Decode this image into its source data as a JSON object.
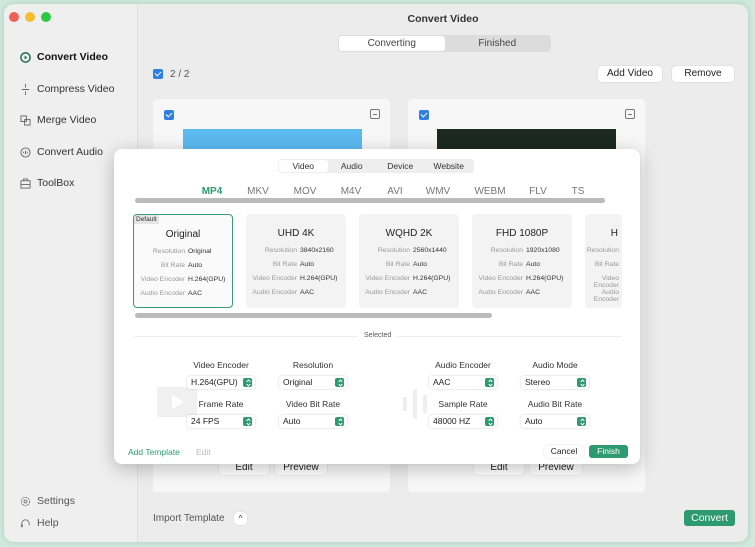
{
  "window": {
    "title": "Convert Video"
  },
  "sidebar": {
    "items": [
      {
        "label": "Convert Video",
        "icon": "convert-video-icon"
      },
      {
        "label": "Compress Video",
        "icon": "compress-icon"
      },
      {
        "label": "Merge Video",
        "icon": "merge-icon"
      },
      {
        "label": "Convert Audio",
        "icon": "audio-icon"
      },
      {
        "label": "ToolBox",
        "icon": "toolbox-icon"
      }
    ],
    "footer": [
      {
        "label": "Settings",
        "icon": "gear-icon"
      },
      {
        "label": "Help",
        "icon": "headset-icon"
      }
    ]
  },
  "main": {
    "tabs": [
      {
        "label": "Converting",
        "active": true
      },
      {
        "label": "Finished"
      }
    ],
    "selection_count": "2 / 2",
    "add_video": "Add Video",
    "remove": "Remove",
    "card_buttons": {
      "edit": "Edit",
      "preview": "Preview"
    },
    "import_template": "Import Template",
    "convert": "Convert"
  },
  "modal": {
    "tabs": [
      {
        "label": "Video",
        "active": true
      },
      {
        "label": "Audio"
      },
      {
        "label": "Device"
      },
      {
        "label": "Website"
      }
    ],
    "formats": [
      "MP4",
      "MKV",
      "MOV",
      "M4V",
      "AVI",
      "WMV",
      "WEBM",
      "FLV",
      "TS"
    ],
    "active_format": "MP4",
    "preset_keys": {
      "resolution": "Resolution",
      "bitrate": "Bit Rate",
      "venc": "Video Encoder",
      "aenc": "Audio Encoder"
    },
    "default_badge": "Default",
    "presets": [
      {
        "name": "Original",
        "resolution": "Original",
        "bitrate": "Auto",
        "venc": "H.264(GPU)",
        "aenc": "AAC"
      },
      {
        "name": "UHD 4K",
        "resolution": "3840x2160",
        "bitrate": "Auto",
        "venc": "H.264(GPU)",
        "aenc": "AAC"
      },
      {
        "name": "WQHD 2K",
        "resolution": "2560x1440",
        "bitrate": "Auto",
        "venc": "H.264(GPU)",
        "aenc": "AAC"
      },
      {
        "name": "FHD 1080P",
        "resolution": "1920x1080",
        "bitrate": "Auto",
        "venc": "H.264(GPU)",
        "aenc": "AAC"
      },
      {
        "name": "H"
      }
    ],
    "selected_label": "Selected",
    "settings": [
      {
        "label": "Video Encoder",
        "value": "H.264(GPU)"
      },
      {
        "label": "Resolution",
        "value": "Original"
      },
      {
        "label": "Audio Encoder",
        "value": "AAC"
      },
      {
        "label": "Audio Mode",
        "value": "Stereo"
      },
      {
        "label": "Frame Rate",
        "value": "24 FPS"
      },
      {
        "label": "Video Bit Rate",
        "value": "Auto"
      },
      {
        "label": "Sample Rate",
        "value": "48000 HZ"
      },
      {
        "label": "Audio Bit Rate",
        "value": "Auto"
      }
    ],
    "add_template": "Add Template",
    "edit": "Edit",
    "cancel": "Cancel",
    "finish": "Finish"
  },
  "colors": {
    "accent": "#2e9a72",
    "checkbox": "#2f7fe0"
  }
}
